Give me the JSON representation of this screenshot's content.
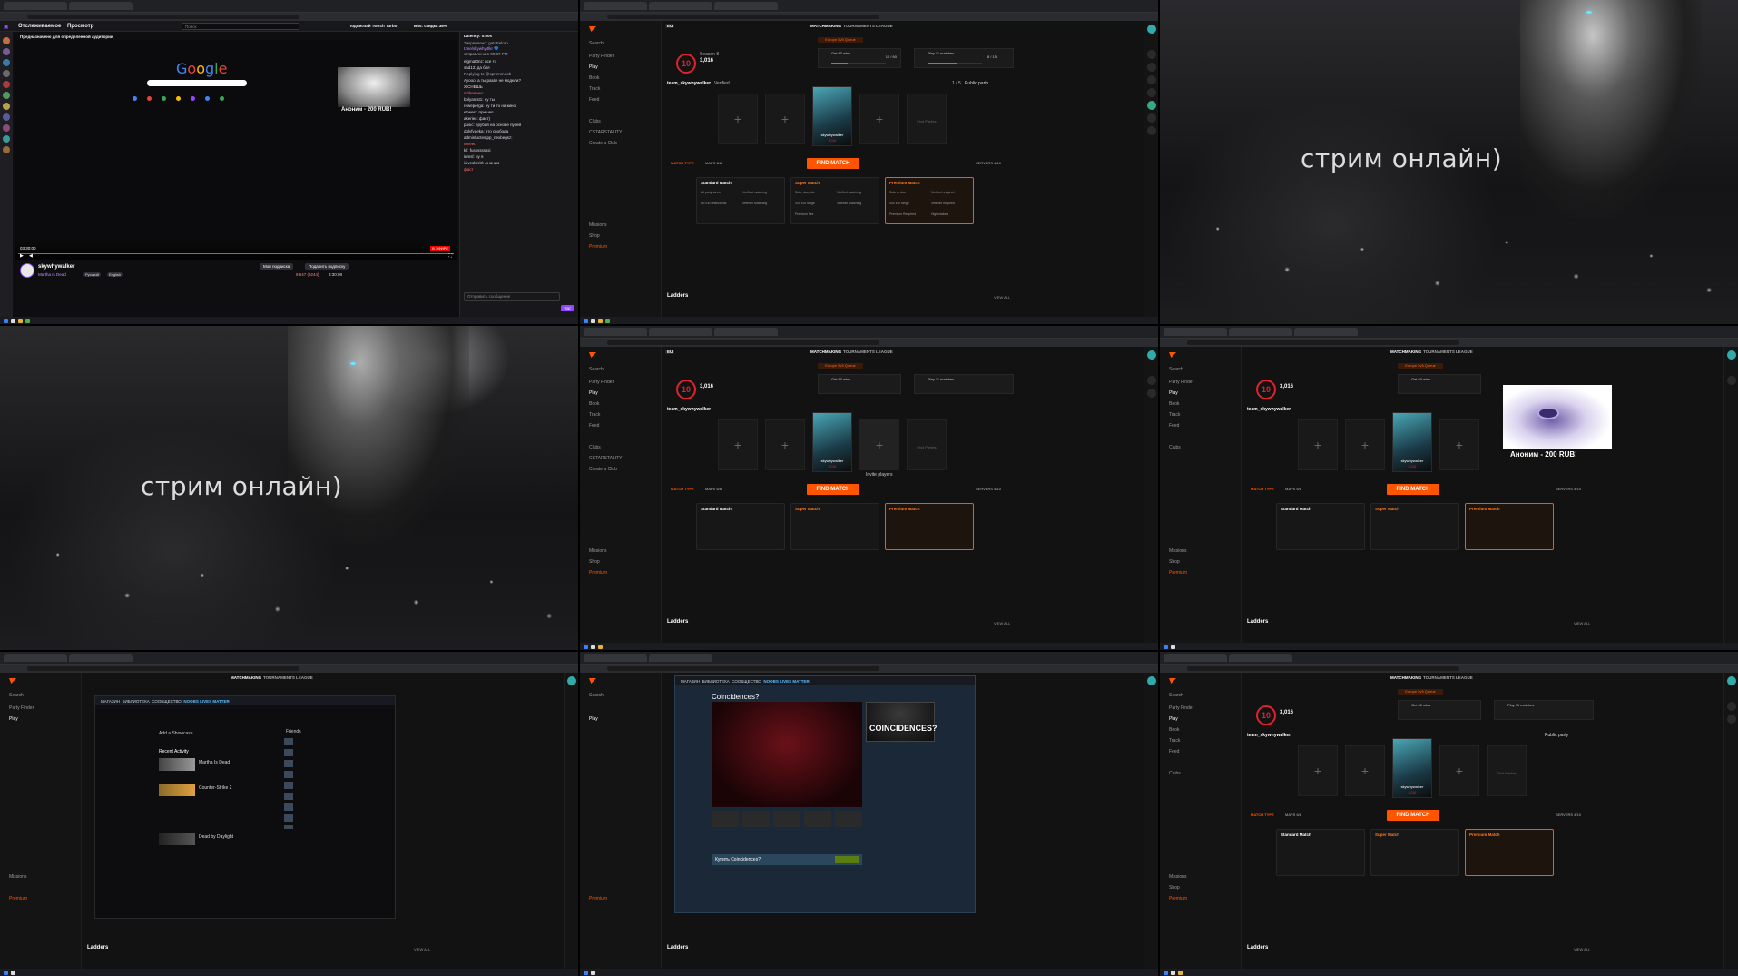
{
  "twitch": {
    "tab_following": "Отслеживаемое",
    "tab_browse": "Просмотр",
    "search_placeholder": "Поиск",
    "turbo": "Подписчай Twitch Turbo",
    "bits": "Bits: скидка 35%",
    "audience_note": "Предназначено для определенной аудитории",
    "latency": "Latency: 0.00s",
    "google": "Google",
    "ad_text": "Аноним - 200 RUB!",
    "time_current": "03:30:00",
    "live_badge": "В ЭФИРЕ",
    "channel": "skywhywalker",
    "game": "Martha Is Dead",
    "tags": [
      "Русский",
      "English"
    ],
    "subscribe": "Мои подписка",
    "gift_sub": "Подарить подписку",
    "viewers": "8 647 (9244)",
    "uptime": "3:30:08",
    "chat_placeholder": "Отправить сообщение",
    "chat_send": "Чат",
    "chat_lines": [
      "Закреплено: gatoFeloro",
      "t.me/skywhy4lkr 💙",
      "отправлено в 09:37 PM",
      "elgmat0nz: все то",
      "sad12: да бля",
      "Replying to @sprmnmoob",
      "Ayooo: а ты разве не модели?",
      "ЖСНЕШЬ",
      "strikeeeee:",
      "bolyanist1: ну ты",
      "reweperga: ну ти то на кино",
      "ezwest: пришел",
      "akeriec: фаст)",
      "pusic: ерубай на основе пусей",
      "dolyfydeka: это свобода",
      "adminfuctestpp_nexbegsz:",
      "toneet:",
      "kil: fussssssssi",
      "inmsl: ну я",
      "iciveskeritl: Аноним",
      "фаст"
    ]
  },
  "faceit": {
    "nav": [
      "MATCHMAKING",
      "TOURNAMENTS",
      "LEAGUE"
    ],
    "region": "EU",
    "queue_banner": "Europe 5v5 Queue",
    "level": "10",
    "elo": "3,016",
    "season": "Season 8",
    "team_name": "team_skywhywalker",
    "verified": "Verified",
    "mission1": "Get 60 wins",
    "mission1_count": "15 / 60",
    "mission2": "Play 11 matches",
    "mission2_count": "8 / 15",
    "party_size": "1 / 5",
    "public_party": "Public party",
    "player_name": "skywhywalker",
    "player_elo": "3,016",
    "find_parties": "Find Parties",
    "invite_players": "Invite players",
    "match_type": "MATCH TYPE",
    "maps": "MAPS 6/8",
    "find_match": "FIND MATCH",
    "servers": "SERVERS 4/10",
    "cards": [
      {
        "title": "Standard Match",
        "size": "5v5",
        "features": [
          "All party sizes",
          "Verified matching",
          "No Elo restrictions",
          "Veteran Matching"
        ]
      },
      {
        "title": "Super Match",
        "size": "5v5",
        "features": [
          "Solo, duo, trio",
          "Verified matching",
          "400 Elo range",
          "Veteran Matching",
          "Premium flex"
        ]
      },
      {
        "title": "Premium Match",
        "size": "5v5",
        "features": [
          "Solo or duo",
          "Verified required",
          "400 Elo range",
          "Veteran required",
          "Premium Required",
          "High stakes"
        ]
      }
    ],
    "sidebar": [
      "Search",
      "Party Finder",
      "Play",
      "Book",
      "Track",
      "Feed",
      "Clubs",
      "CSTARSTALITY",
      "Create a Club",
      "Missions",
      "Shop",
      "Premium"
    ],
    "ladders": "Ladders",
    "view_all": "VIEW ALL",
    "ad_text": "Аноним - 200 RUB!"
  },
  "wallpaper": {
    "caption": "стрим онлайн)"
  },
  "steam": {
    "tabs": [
      "МАГАЗИН",
      "БИБЛИОТЕКА",
      "СООБЩЕСТВО",
      "NOOBS LIVES MATTER"
    ],
    "library_title": "Recent Activity",
    "showcase": "Add a Showcase",
    "game1": "Martha Is Dead",
    "game2": "Counter-Strike 2",
    "game3": "Dead by Daylight",
    "friends": "Friends",
    "product_title": "Coincidences?",
    "product_caption": "COINCIDENCES?",
    "buy_label": "Купить Coincidences?"
  },
  "colors": {
    "faceit_orange": "#ff5500",
    "level_red": "#e0212e",
    "twitch_purple": "#9147ff"
  }
}
